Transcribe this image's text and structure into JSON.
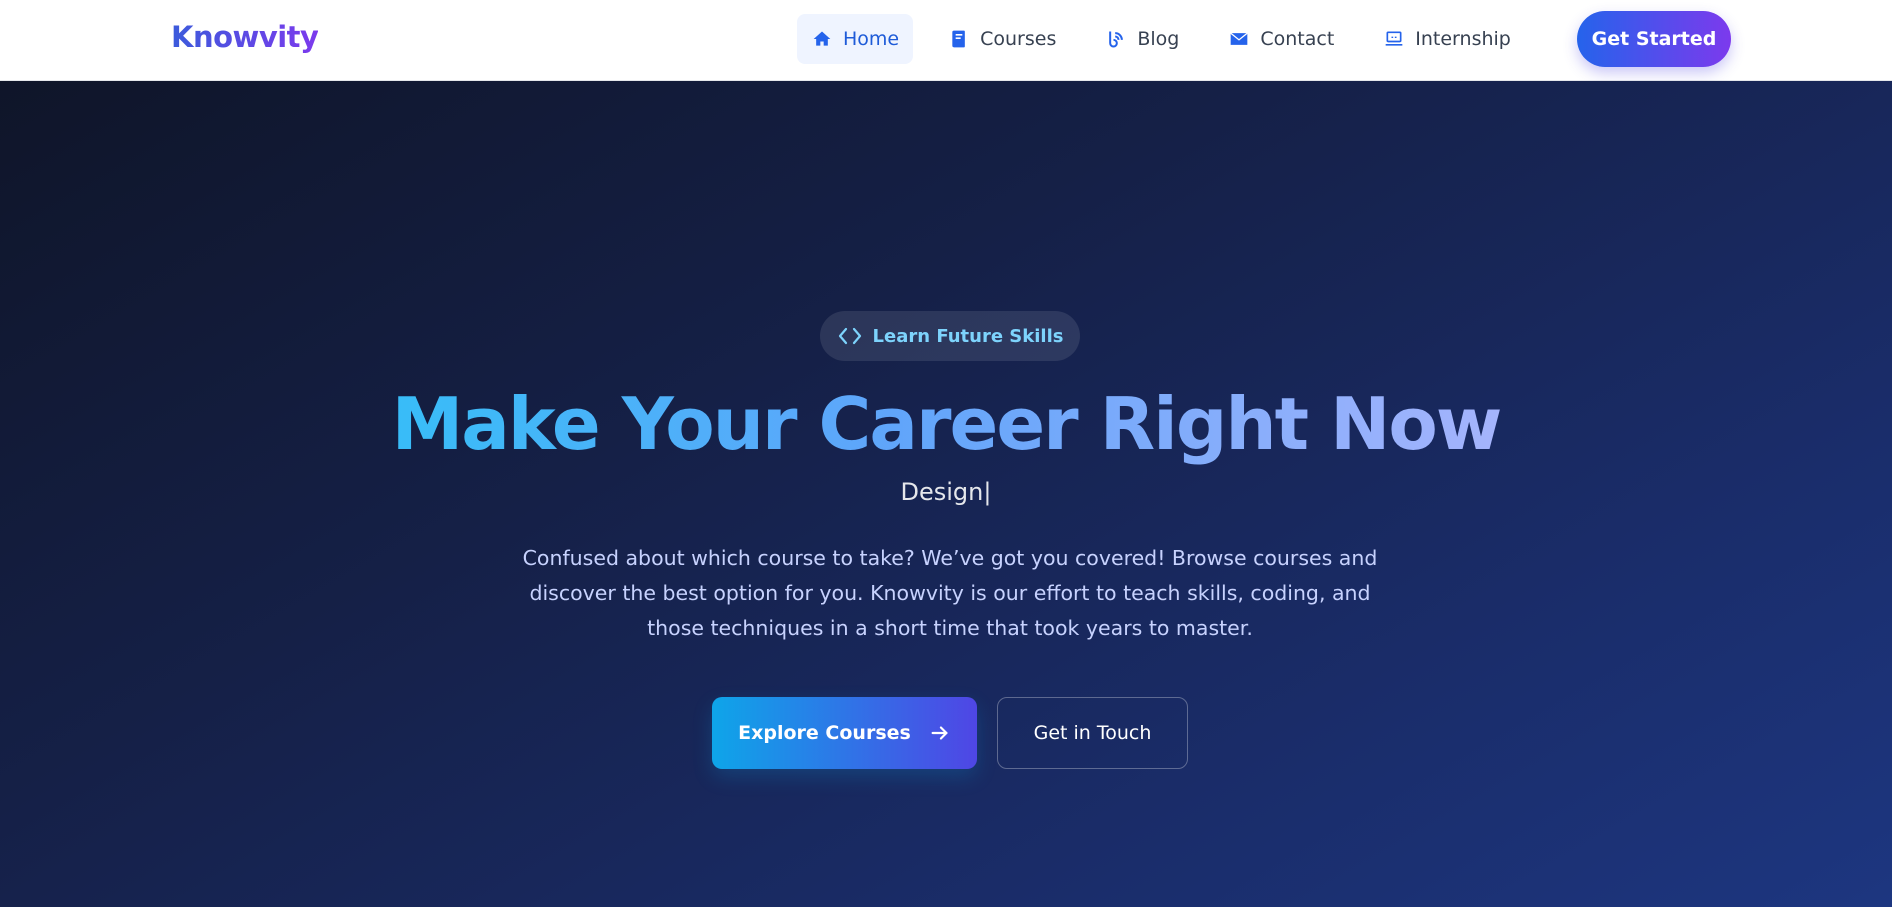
{
  "brand": {
    "name": "Knowvity"
  },
  "nav": {
    "items": [
      {
        "label": "Home",
        "icon": "home-icon",
        "active": true
      },
      {
        "label": "Courses",
        "icon": "book-icon",
        "active": false
      },
      {
        "label": "Blog",
        "icon": "blog-icon",
        "active": false
      },
      {
        "label": "Contact",
        "icon": "envelope-icon",
        "active": false
      },
      {
        "label": "Internship",
        "icon": "laptop-icon",
        "active": false
      }
    ],
    "cta_label": "Get Started"
  },
  "hero": {
    "badge_label": "Learn Future Skills",
    "badge_icon": "code-icon",
    "headline": "Make Your Career Right Now",
    "typed_text": "Design|",
    "description": "Confused about which course to take? We’ve got you covered! Browse courses and discover the best option for you. Knowvity is our effort to teach skills, coding, and those techniques in a short time that took years to master.",
    "primary_button": {
      "label": "Explore Courses",
      "icon": "arrow-right-icon"
    },
    "secondary_button": {
      "label": "Get in Touch"
    }
  },
  "colors": {
    "brand_gradient": [
      "#3b5bdb",
      "#7c3aed"
    ],
    "nav_active": "#1e5bd8",
    "hero_bg": [
      "#0f1529",
      "#1d3680"
    ],
    "accent_cyan": "#7dd3fc"
  }
}
